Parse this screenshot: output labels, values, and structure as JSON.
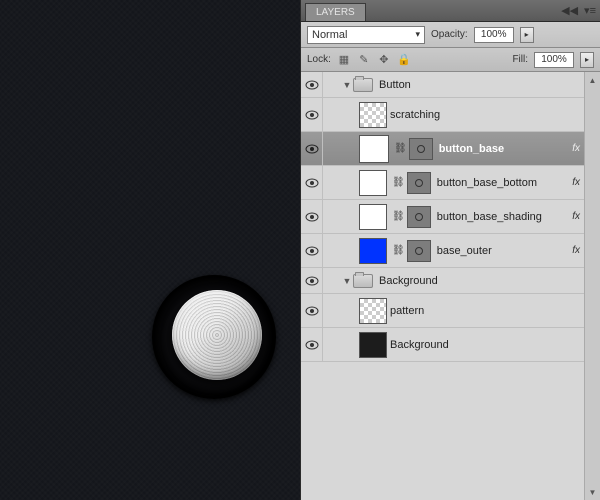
{
  "panel": {
    "tab_label": "LAYERS",
    "blend_mode": "Normal",
    "opacity_label": "Opacity:",
    "opacity_value": "100%",
    "lock_label": "Lock:",
    "fill_label": "Fill:",
    "fill_value": "100%"
  },
  "groups": [
    {
      "name": "Button",
      "expanded": true,
      "layers": [
        {
          "name": "scratching",
          "thumb": "chk",
          "mask": false,
          "fx": false,
          "selected": false
        },
        {
          "name": "button_base",
          "thumb": "white",
          "mask": true,
          "fx": true,
          "selected": true
        },
        {
          "name": "button_base_bottom",
          "thumb": "white",
          "mask": true,
          "fx": true,
          "selected": false
        },
        {
          "name": "button_base_shading",
          "thumb": "white",
          "mask": true,
          "fx": true,
          "selected": false
        },
        {
          "name": "base_outer",
          "thumb": "blue",
          "mask": true,
          "fx": true,
          "selected": false
        }
      ]
    },
    {
      "name": "Background",
      "expanded": true,
      "layers": [
        {
          "name": "pattern",
          "thumb": "chk",
          "mask": false,
          "fx": false,
          "selected": false
        },
        {
          "name": "Background",
          "thumb": "dark",
          "mask": false,
          "fx": false,
          "selected": false
        }
      ]
    }
  ]
}
